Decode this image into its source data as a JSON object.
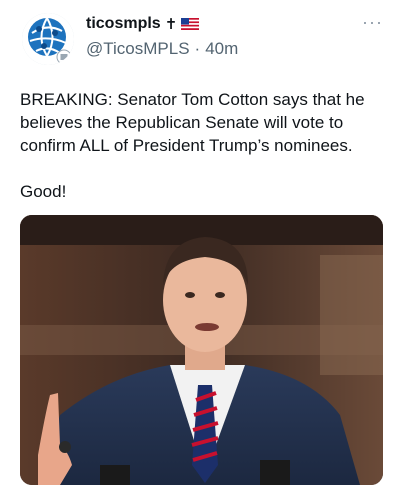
{
  "tweet": {
    "display_name": "ticosmpls",
    "name_cross": "✝",
    "handle": "@TicosMPLS",
    "separator": "·",
    "time": "40m",
    "more_label": "···",
    "text_line1": "BREAKING: Senator Tom Cotton says that he believes the Republican Senate will vote to confirm ALL of President Trump’s nominees.",
    "text_line2": "Good!"
  },
  "icons": {
    "avatar": "globe-logo-avatar",
    "flag": "us-flag-icon",
    "more": "more-options-icon"
  },
  "colors": {
    "text": "#0f1419",
    "secondary": "#536471",
    "globe_blue": "#1e73be"
  }
}
